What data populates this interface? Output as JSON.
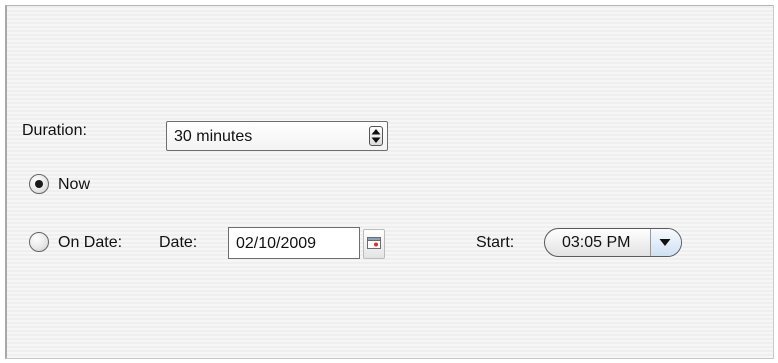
{
  "duration": {
    "label": "Duration:",
    "value": "30 minutes"
  },
  "schedule": {
    "now_label": "Now",
    "now_selected": true,
    "on_date_label": "On Date:",
    "on_date_selected": false,
    "date_label": "Date:",
    "date_value": "02/10/2009",
    "start_label": "Start:",
    "start_value": "03:05 PM"
  },
  "icons": {
    "spinner": "up-down-arrows-icon",
    "calendar": "calendar-icon",
    "dropdown": "chevron-down-icon"
  }
}
